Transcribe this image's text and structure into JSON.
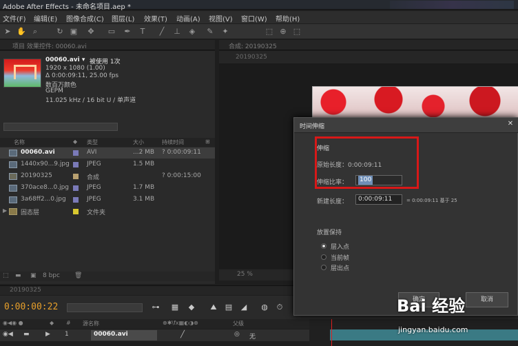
{
  "app": {
    "title": "Adobe After Effects - 未命名项目.aep *"
  },
  "menu": [
    "文件(F)",
    "编辑(E)",
    "图像合成(C)",
    "图层(L)",
    "效果(T)",
    "动画(A)",
    "视图(V)",
    "窗口(W)",
    "帮助(H)"
  ],
  "project_panel": {
    "tab": "项目 效果控件: 00060.avi",
    "selected_file": {
      "name": "00060.avi ▾",
      "used": "被使用 1次",
      "line1": "1920 x 1080 (1.00)",
      "line2": "Δ 0:00:09:11, 25.00 fps",
      "line3": "数百万颜色",
      "line4": "GEPM",
      "line5": "11.025 kHz / 16 bit U / 单声道"
    },
    "columns": {
      "name": "名称",
      "type": "类型",
      "size": "大小",
      "duration": "持续时间"
    },
    "items": [
      {
        "name": "00060.avi",
        "type": "AVI",
        "size": "...2 MB",
        "duration": "? 0:00:09:11",
        "chip": "#7a7ab8",
        "selected": true
      },
      {
        "name": "1440x90...9.jpg",
        "type": "JPEG",
        "size": "1.5 MB",
        "duration": "",
        "chip": "#7a7ab8",
        "selected": false
      },
      {
        "name": "20190325",
        "type": "合成",
        "size": "",
        "duration": "? 0:00:15:00",
        "chip": "#b8a070",
        "selected": false
      },
      {
        "name": "370ace8...0.jpg",
        "type": "JPEG",
        "size": "1.7 MB",
        "duration": "",
        "chip": "#7a7ab8",
        "selected": false
      },
      {
        "name": "3a68ff2...0.jpg",
        "type": "JPEG",
        "size": "3.1 MB",
        "duration": "",
        "chip": "#7a7ab8",
        "selected": false
      },
      {
        "name": "固态层",
        "type": "文件夹",
        "size": "",
        "duration": "",
        "chip": "#d8c830",
        "selected": false
      }
    ],
    "bpc": "8 bpc"
  },
  "comp_panel": {
    "tab": "合成: 20190325",
    "sub": "20190325",
    "zoom": "25 %"
  },
  "timeline": {
    "tab": "20190325",
    "timecode": "0:00:00:22",
    "head": {
      "source": "源名称",
      "parent": "父级"
    },
    "layer": {
      "index": "1",
      "name": "00060.avi",
      "parent": "无"
    }
  },
  "dialog": {
    "title": "时间伸缩",
    "stretch_group": "伸缩",
    "original_label": "原始长度：0:00:09:11",
    "ratio_label": "伸缩比率：",
    "ratio_value": "100",
    "new_label": "新建长度：",
    "new_value": "0:00:09:11",
    "new_note": "= 0:00:09:11  基于 25",
    "hold_group": "放置保持",
    "radios": [
      "层入点",
      "当前帧",
      "层出点"
    ],
    "ok": "确定",
    "cancel": "取消"
  },
  "watermark": {
    "logo": "Bai 经验",
    "url": "jingyan.baidu.com"
  }
}
